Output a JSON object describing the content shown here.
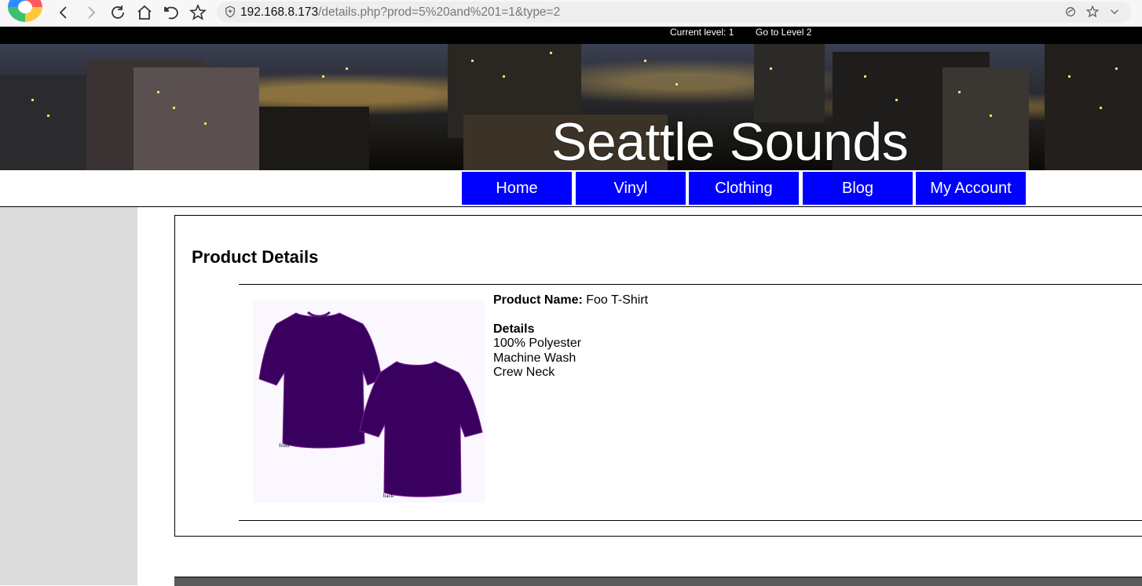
{
  "browser": {
    "url_host": "192.168.8.173",
    "url_path": "/details.php?prod=5%20and%201=1&type=2"
  },
  "topbar": {
    "level_label": "Current level: 1",
    "level_link": "Go to Level 2"
  },
  "banner": {
    "title": "Seattle Sounds"
  },
  "menu": {
    "items": [
      {
        "label": "Home"
      },
      {
        "label": "Vinyl"
      },
      {
        "label": "Clothing"
      },
      {
        "label": "Blog"
      },
      {
        "label": "My Account"
      }
    ]
  },
  "page": {
    "title": "Product Details"
  },
  "product": {
    "name_label": "Product Name:",
    "name": "Foo T-Shirt",
    "details_label": "Details",
    "details": [
      "100% Polyester",
      "Machine Wash",
      "Crew Neck"
    ],
    "image_labels": {
      "front": "front",
      "back": "back"
    },
    "shirt_color": "#3a0060"
  },
  "colors": {
    "menu_blue": "#0000ff",
    "sidebar": "#dcdcdc",
    "footer": "#5a5a5a"
  }
}
